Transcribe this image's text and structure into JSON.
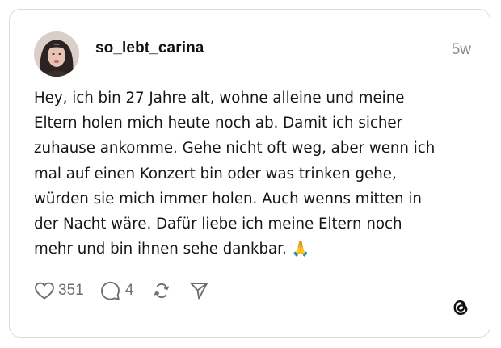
{
  "post": {
    "username": "so_lebt_carina",
    "timestamp": "5w",
    "text": "Hey, ich bin 27 Jahre alt, wohne alleine und meine\nEltern holen mich heute noch ab. Damit ich sicher\nzuhause ankomme. Gehe nicht oft weg, aber wenn ich\nmal auf einen Konzert bin oder was trinken gehe,\nwürden sie mich immer holen. Auch wenns mitten in\nder Nacht wäre. Dafür liebe ich meine Eltern noch\nmehr und bin ihnen sehe dankbar. 🙏"
  },
  "actions": {
    "likes": "351",
    "replies": "4",
    "like_icon": "heart-icon",
    "reply_icon": "comment-icon",
    "repost_icon": "repost-icon",
    "share_icon": "send-icon"
  },
  "brand": {
    "logo": "threads-logo",
    "text_color": "#161616",
    "muted_color": "#6e6e6e",
    "border_color": "#dadada"
  }
}
